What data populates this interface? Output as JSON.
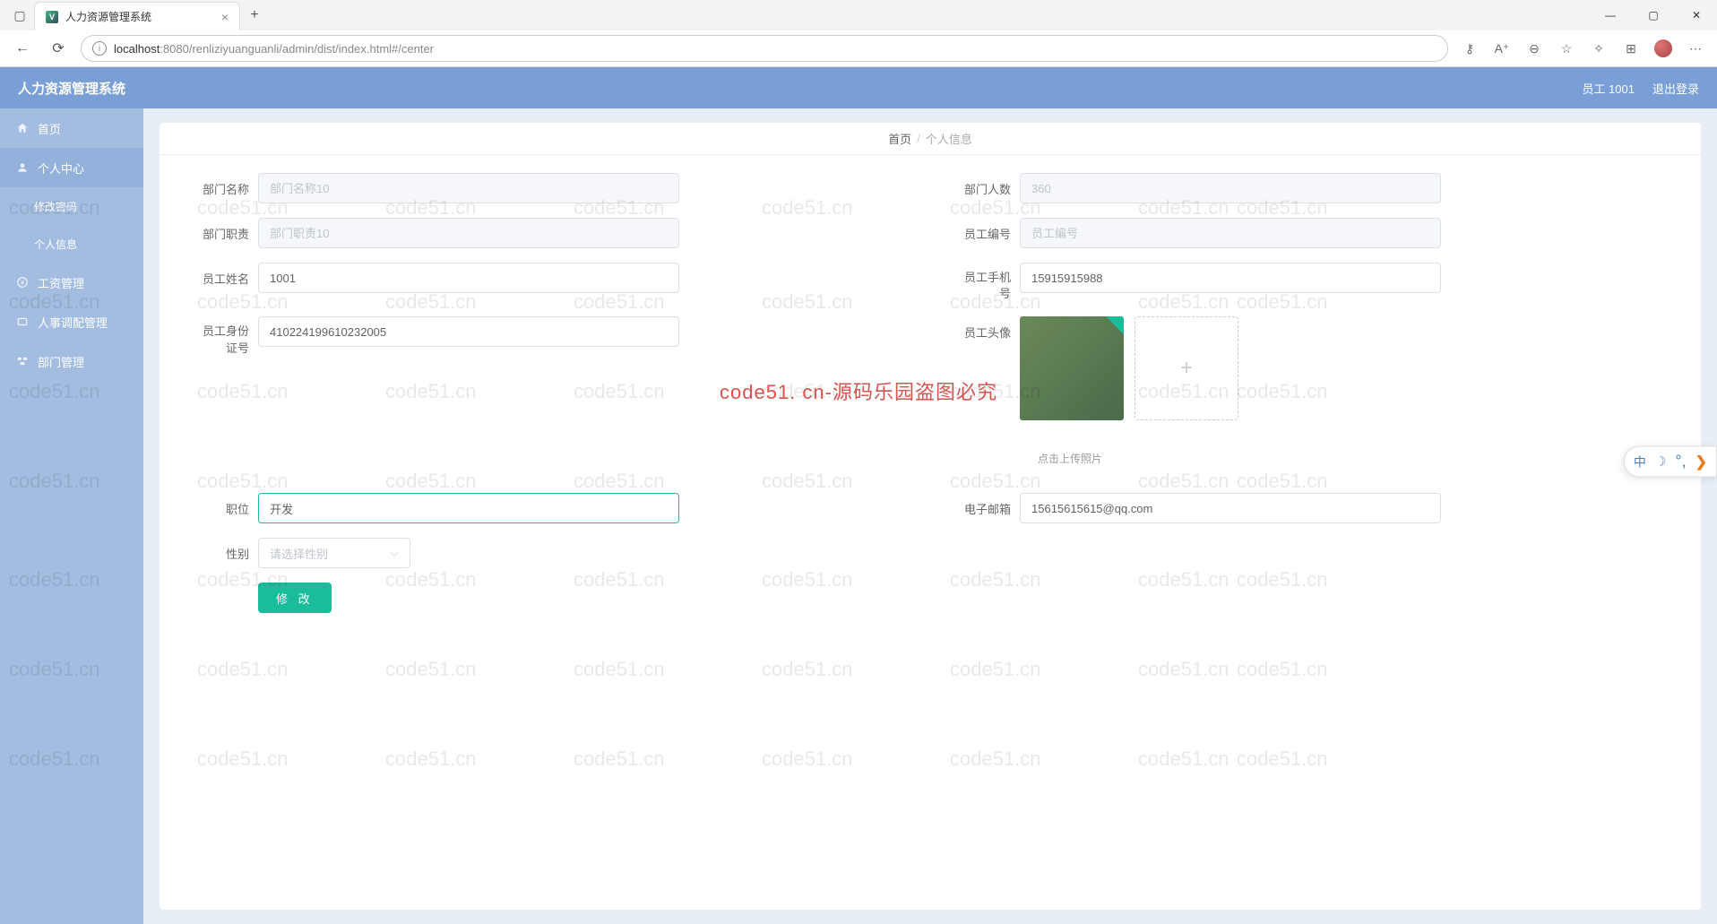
{
  "browser": {
    "tab_title": "人力资源管理系统",
    "url_host": "localhost",
    "url_port": ":8080",
    "url_path": "/renliziyuanguanli/admin/dist/index.html#/center"
  },
  "header": {
    "app_title": "人力资源管理系统",
    "user_label": "员工 1001",
    "logout": "退出登录"
  },
  "sidebar": {
    "items": [
      {
        "icon": "home",
        "label": "首页"
      },
      {
        "icon": "user",
        "label": "个人中心"
      },
      {
        "icon": "money",
        "label": "工资管理"
      },
      {
        "icon": "transfer",
        "label": "人事调配管理"
      },
      {
        "icon": "dept",
        "label": "部门管理"
      }
    ],
    "subs": [
      {
        "label": "修改密码"
      },
      {
        "label": "个人信息"
      }
    ]
  },
  "breadcrumb": {
    "home": "首页",
    "current": "个人信息"
  },
  "form": {
    "dept_name": {
      "label": "部门名称",
      "placeholder": "部门名称10",
      "value": ""
    },
    "dept_count": {
      "label": "部门人数",
      "placeholder": "360",
      "value": ""
    },
    "dept_duty": {
      "label": "部门职责",
      "placeholder": "部门职责10",
      "value": ""
    },
    "emp_no": {
      "label": "员工编号",
      "placeholder": "员工编号",
      "value": ""
    },
    "emp_name": {
      "label": "员工姓名",
      "value": "1001"
    },
    "emp_phone": {
      "label": "员工手机号",
      "value": "15915915988"
    },
    "emp_id": {
      "label": "员工身份证号",
      "value": "410224199610232005"
    },
    "avatar": {
      "label": "员工头像",
      "hint": "点击上传照片"
    },
    "position": {
      "label": "职位",
      "value": "开发"
    },
    "email": {
      "label": "电子邮箱",
      "value": "15615615615@qq.com"
    },
    "gender": {
      "label": "性别",
      "placeholder": "请选择性别"
    },
    "submit": "修 改"
  },
  "watermark": {
    "main": "code51. cn-源码乐园盗图必究",
    "cell": "code51.cn"
  },
  "float": {
    "cn": "中"
  }
}
